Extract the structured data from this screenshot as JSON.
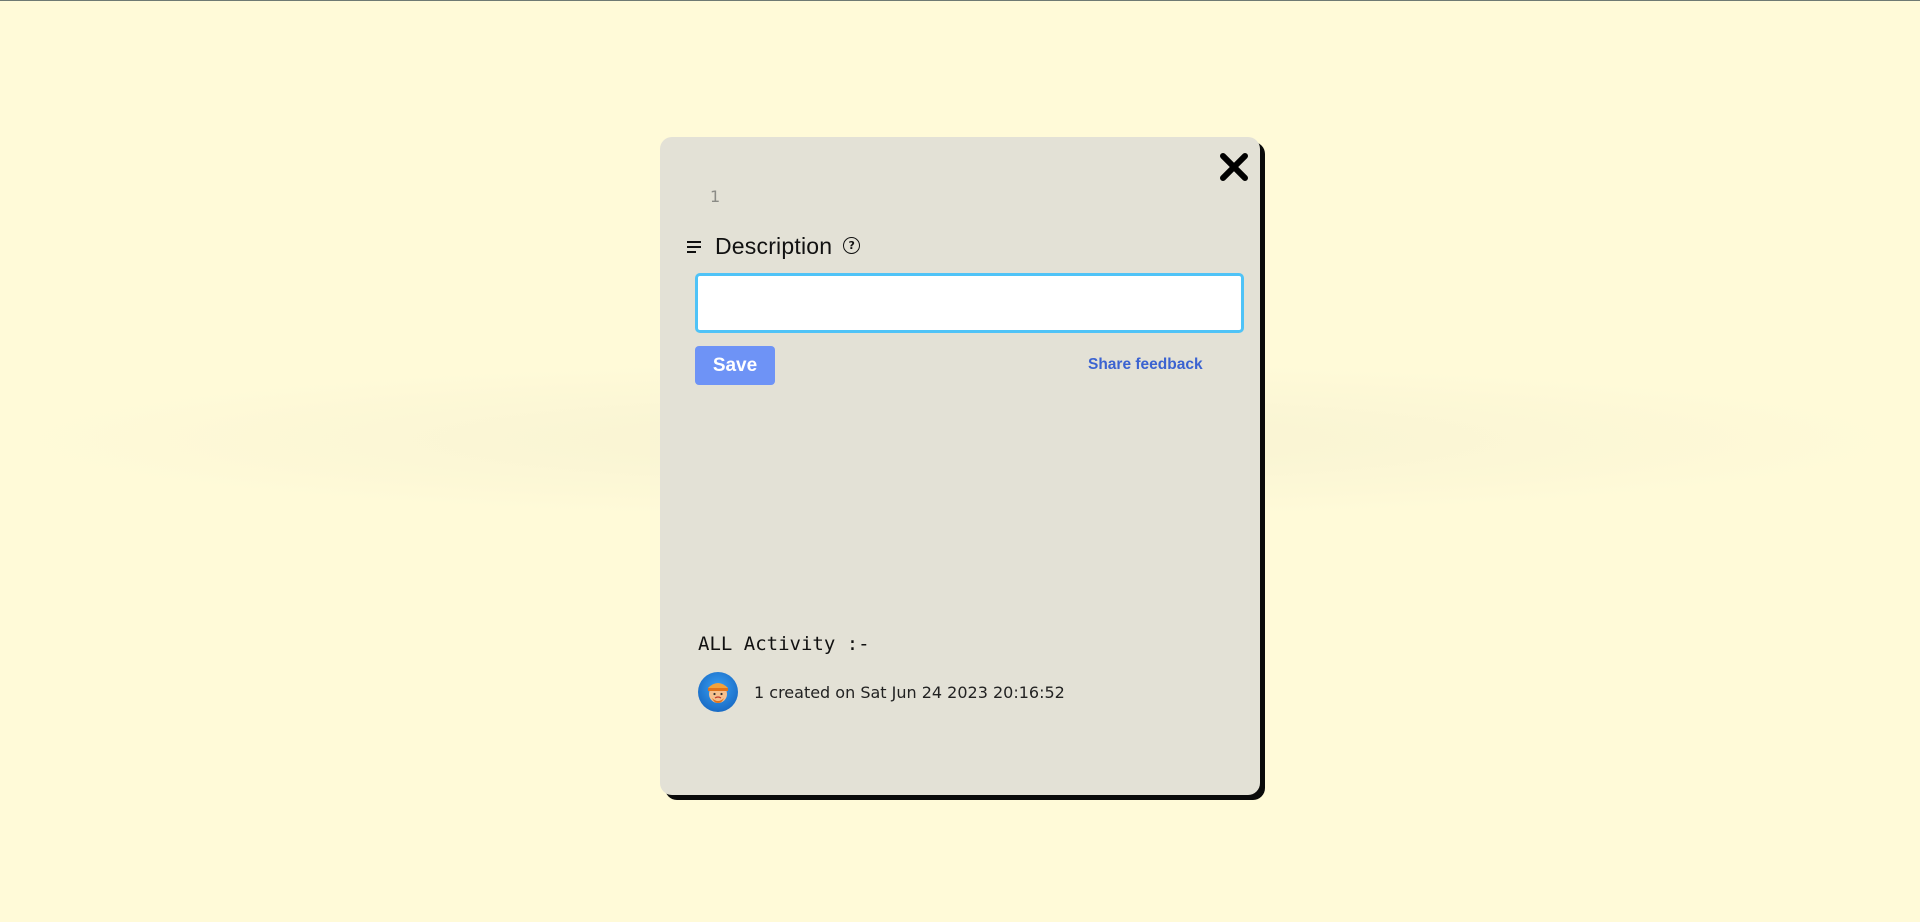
{
  "card": {
    "title": "1"
  },
  "description": {
    "heading": "Description",
    "help_icon": "question-circle-icon",
    "menu_icon": "text-lines-icon",
    "input_value": "",
    "input_placeholder": ""
  },
  "actions": {
    "save_label": "Save",
    "feedback_label": "Share feedback"
  },
  "activity": {
    "heading": "ALL Activity :-",
    "items": [
      {
        "avatar_icon": "user-avatar-icon",
        "text": "1 created on Sat Jun 24 2023 20:16:52"
      }
    ]
  },
  "close_icon": "close-x-icon",
  "colors": {
    "page_background": "#fffad8",
    "modal_background": "#e3e1d6",
    "input_border": "#4fc3f7",
    "save_button": "#6e93f6",
    "link": "#3b63d1"
  }
}
